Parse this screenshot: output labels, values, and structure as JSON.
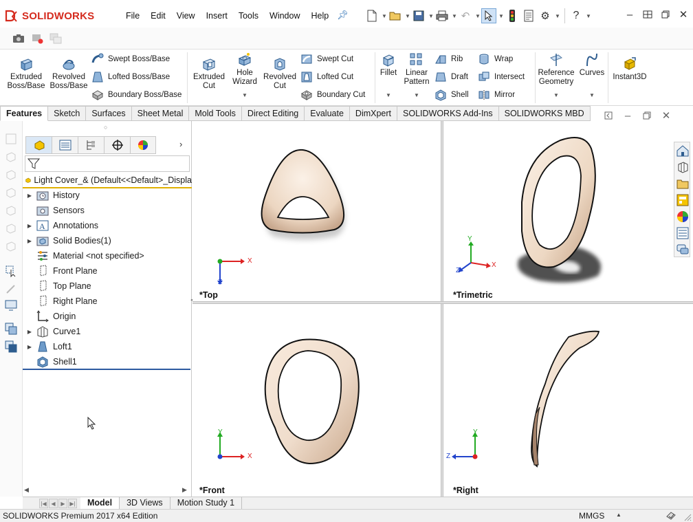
{
  "app": {
    "brand": "SOLIDWORKS",
    "menus": [
      "File",
      "Edit",
      "View",
      "Insert",
      "Tools",
      "Window",
      "Help"
    ]
  },
  "ribbon": {
    "extruded_boss": [
      "Extruded",
      "Boss/Base"
    ],
    "revolved_boss": [
      "Revolved",
      "Boss/Base"
    ],
    "swept_boss": "Swept Boss/Base",
    "lofted_boss": "Lofted Boss/Base",
    "boundary_boss": "Boundary Boss/Base",
    "extruded_cut": [
      "Extruded",
      "Cut"
    ],
    "hole_wizard": [
      "Hole",
      "Wizard"
    ],
    "revolved_cut": [
      "Revolved",
      "Cut"
    ],
    "swept_cut": "Swept Cut",
    "lofted_cut": "Lofted Cut",
    "boundary_cut": "Boundary Cut",
    "fillet": "Fillet",
    "linear_pattern": [
      "Linear",
      "Pattern"
    ],
    "rib": "Rib",
    "draft": "Draft",
    "shell": "Shell",
    "wrap": "Wrap",
    "intersect": "Intersect",
    "mirror": "Mirror",
    "reference_geometry": [
      "Reference",
      "Geometry"
    ],
    "curves": "Curves",
    "instant3d": "Instant3D"
  },
  "command_tabs": [
    "Features",
    "Sketch",
    "Surfaces",
    "Sheet Metal",
    "Mold Tools",
    "Direct Editing",
    "Evaluate",
    "DimXpert",
    "SOLIDWORKS Add-Ins",
    "SOLIDWORKS MBD"
  ],
  "feature_tree": {
    "root": "Light Cover_&  (Default<<Default>_Displa",
    "items": [
      {
        "label": "History",
        "icon": "history-folder-icon",
        "expandable": true
      },
      {
        "label": "Sensors",
        "icon": "sensors-folder-icon",
        "expandable": false
      },
      {
        "label": "Annotations",
        "icon": "annotations-icon",
        "expandable": true
      },
      {
        "label": "Solid Bodies(1)",
        "icon": "solid-bodies-icon",
        "expandable": true
      },
      {
        "label": "Material <not specified>",
        "icon": "material-icon",
        "expandable": false
      },
      {
        "label": "Front Plane",
        "icon": "plane-icon",
        "expandable": false
      },
      {
        "label": "Top Plane",
        "icon": "plane-icon",
        "expandable": false
      },
      {
        "label": "Right Plane",
        "icon": "plane-icon",
        "expandable": false
      },
      {
        "label": "Origin",
        "icon": "origin-icon",
        "expandable": false
      },
      {
        "label": "Curve1",
        "icon": "curve-icon",
        "expandable": true
      },
      {
        "label": "Loft1",
        "icon": "loft-icon",
        "expandable": true
      },
      {
        "label": "Shell1",
        "icon": "shell-icon",
        "expandable": false
      }
    ]
  },
  "viewports": {
    "top": "*Top",
    "trimetric": "*Trimetric",
    "front": "*Front",
    "right": "*Right"
  },
  "axes": {
    "x": "X",
    "y": "Y",
    "z": "Z"
  },
  "bottom_tabs": [
    "Model",
    "3D Views",
    "Motion Study 1"
  ],
  "status": {
    "edition": "SOLIDWORKS Premium 2017 x64 Edition",
    "units": "MMGS",
    "units_caret": "▲"
  },
  "colors": {
    "brand_red": "#d52b1e",
    "part_fill": "#f3e3d3",
    "part_shade": "#d8bca4",
    "tree_root_underline": "#e0b000",
    "active_blue": "#2d5aa0"
  }
}
